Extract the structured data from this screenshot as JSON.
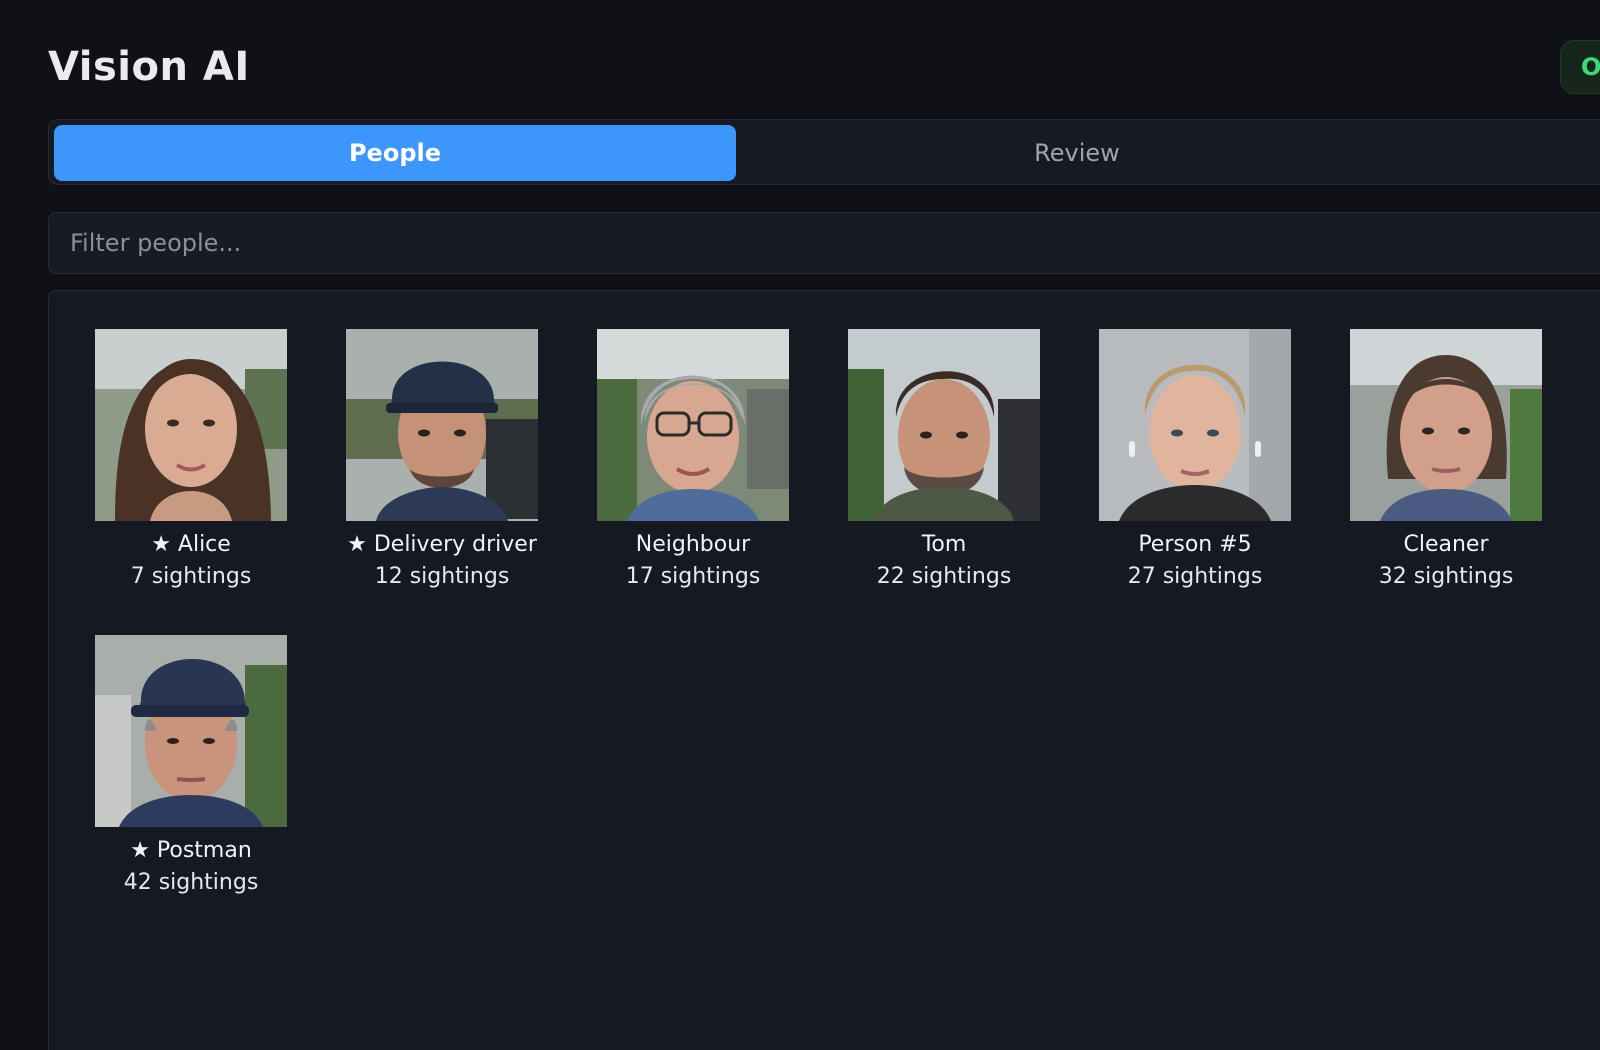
{
  "app": {
    "title": "Vision AI",
    "status_label": "O"
  },
  "tabs": [
    {
      "label": "People",
      "active": true
    },
    {
      "label": "Review",
      "active": false
    }
  ],
  "filter": {
    "placeholder": "Filter people...",
    "value": ""
  },
  "people": [
    {
      "name": "★ Alice",
      "sightings": "7 sightings"
    },
    {
      "name": "★ Delivery driver",
      "sightings": "12 sightings"
    },
    {
      "name": "Neighbour",
      "sightings": "17 sightings"
    },
    {
      "name": "Tom",
      "sightings": "22 sightings"
    },
    {
      "name": "Person #5",
      "sightings": "27 sightings"
    },
    {
      "name": "Cleaner",
      "sightings": "32 sightings"
    },
    {
      "name": "★ Postman",
      "sightings": "42 sightings"
    }
  ],
  "colors": {
    "accent": "#3d96fb",
    "status": "#3ddc73",
    "background": "#0f1117"
  }
}
